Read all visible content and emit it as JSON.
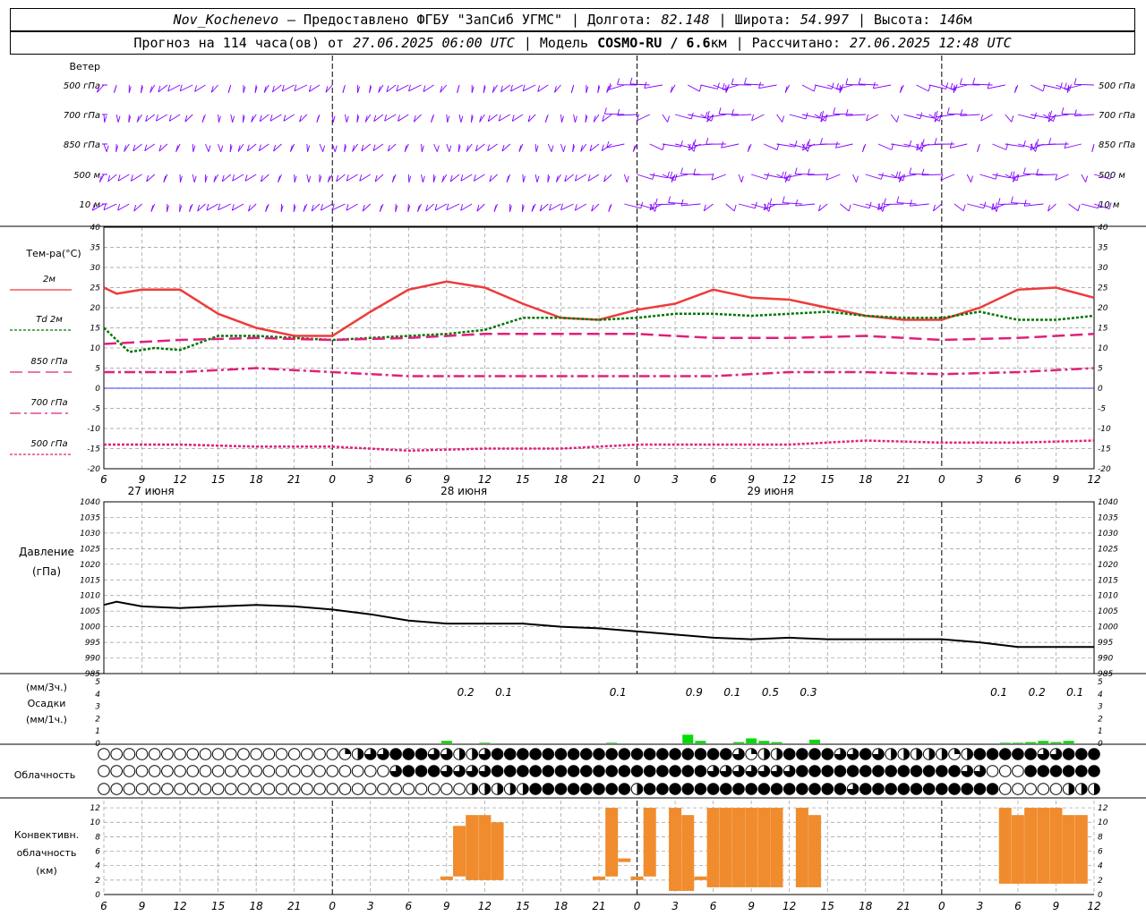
{
  "header": {
    "station": "Nov_Kochenevo",
    "provider": "– Предоставлено ФГБУ \"ЗапСиб УГМС\"",
    "lon_label": "| Долгота:",
    "lon": "82.148",
    "lat_label": "| Широта:",
    "lat": "54.997",
    "alt_label": "| Высота:",
    "alt": "146",
    "alt_unit": "м",
    "forecast_label": "Прогноз на 114 часа(ов) от",
    "forecast_start": "27.06.2025 06:00 UTC",
    "model_label": "| Модель",
    "model": "COSMO-RU / 6.6",
    "model_unit": "км",
    "calc_label": "| Рассчитано:",
    "calc_time": "27.06.2025 12:48 UTC"
  },
  "labels": {
    "wind_title": "Ветер",
    "wind_levels": [
      "500 гПа",
      "700 гПа",
      "850 гПа",
      "500 м",
      "10 м"
    ],
    "temp_title": "Тем-ра(°С)",
    "temp_legend": [
      "2м",
      "Td 2м",
      "850 гПа",
      "700 гПа",
      "500 гПа"
    ],
    "pressure_title": "Давление",
    "pressure_unit": "(гПа)",
    "precip_lines": [
      "(мм/3ч.)",
      "Осадки",
      "(мм/1ч.)"
    ],
    "cloud_title": "Облачность",
    "conv_lines": [
      "Конвективн.",
      "облачность",
      "(км)"
    ]
  },
  "colors": {
    "t2m": "#ee3b3b",
    "td2m": "#007700",
    "t850": "#e0207a",
    "t700": "#e0207a",
    "t500": "#e0207a",
    "wind": "#8000ff",
    "pressure": "#000000",
    "precip": "#00dd00",
    "conv": "#f08c2e",
    "zero_line": "#0000ff"
  },
  "chart_data": {
    "type": "line",
    "x_hours_utc": [
      6,
      9,
      12,
      15,
      18,
      21,
      0,
      3,
      6,
      9,
      12,
      15,
      18,
      21,
      0,
      3,
      6,
      9,
      12,
      15,
      18,
      21,
      0,
      3,
      6,
      9,
      12
    ],
    "x_days": [
      "27 июня",
      "28 июня",
      "29 июня"
    ],
    "x_max_hours": 78,
    "temperature": {
      "ylim": [
        -20,
        40
      ],
      "yticks": [
        -20,
        -15,
        -10,
        -5,
        0,
        5,
        10,
        15,
        20,
        25,
        30,
        35,
        40
      ],
      "series": [
        {
          "name": "2м",
          "x": [
            0,
            1,
            3,
            6,
            9,
            12,
            15,
            18,
            21,
            24,
            27,
            30,
            33,
            36,
            39,
            42,
            45,
            48,
            51,
            54,
            57,
            60,
            63,
            66,
            69,
            72,
            75,
            78
          ],
          "values": [
            25,
            23.5,
            24.5,
            24.5,
            18.5,
            15,
            13,
            13,
            19,
            24.5,
            26.5,
            25,
            21,
            17.5,
            17,
            19.5,
            21,
            24.5,
            22.5,
            22,
            20,
            18,
            17,
            17,
            20,
            24.5,
            25,
            22.5
          ]
        },
        {
          "name": "Td 2м",
          "x": [
            0,
            2,
            4,
            6,
            9,
            12,
            15,
            18,
            21,
            24,
            27,
            30,
            33,
            36,
            39,
            42,
            45,
            48,
            51,
            54,
            57,
            60,
            63,
            66,
            69,
            72,
            75,
            78
          ],
          "values": [
            15,
            9,
            10,
            9.5,
            13,
            13,
            12.5,
            12,
            12.5,
            13,
            13.5,
            14.5,
            17.5,
            17.5,
            17,
            17.5,
            18.5,
            18.5,
            18,
            18.5,
            19,
            18,
            17.5,
            17.5,
            19,
            17,
            17,
            18
          ]
        },
        {
          "name": "850 гПа",
          "x": [
            0,
            6,
            12,
            18,
            24,
            30,
            36,
            42,
            48,
            54,
            60,
            66,
            72,
            78
          ],
          "values": [
            11,
            12,
            12.5,
            12,
            12.5,
            13.5,
            13.5,
            13.5,
            12.5,
            12.5,
            13,
            12,
            12.5,
            13.5
          ]
        },
        {
          "name": "700 гПа",
          "x": [
            0,
            6,
            12,
            18,
            24,
            30,
            36,
            42,
            48,
            54,
            60,
            66,
            72,
            78
          ],
          "values": [
            4,
            4,
            5,
            4,
            3,
            3,
            3,
            3,
            3,
            4,
            4,
            3.5,
            4,
            5
          ]
        },
        {
          "name": "500 гПа",
          "x": [
            0,
            6,
            12,
            18,
            24,
            30,
            36,
            42,
            48,
            54,
            60,
            66,
            72,
            78
          ],
          "values": [
            -14,
            -14,
            -14.5,
            -14.5,
            -15.5,
            -15,
            -15,
            -14,
            -14,
            -14,
            -13,
            -13.5,
            -13.5,
            -13
          ]
        }
      ]
    },
    "pressure": {
      "ylim": [
        985,
        1040
      ],
      "yticks": [
        985,
        990,
        995,
        1000,
        1005,
        1010,
        1015,
        1020,
        1025,
        1030,
        1035,
        1040
      ],
      "x": [
        0,
        1,
        3,
        6,
        9,
        12,
        15,
        18,
        21,
        24,
        27,
        30,
        33,
        36,
        39,
        42,
        45,
        48,
        51,
        54,
        57,
        60,
        63,
        66,
        69,
        72,
        75,
        78
      ],
      "values": [
        1007,
        1008,
        1006.5,
        1006,
        1006.5,
        1007,
        1006.5,
        1005.5,
        1004,
        1002,
        1001,
        1001,
        1001,
        1000,
        999.5,
        998.5,
        997.5,
        996.5,
        996,
        996.5,
        996,
        996,
        996,
        996,
        995,
        993.5,
        993.5,
        993.5
      ]
    },
    "precipitation": {
      "ylim": [
        0,
        5
      ],
      "yticks": [
        0,
        1,
        2,
        3,
        4,
        5
      ],
      "labels": [
        {
          "x": 28.5,
          "text": "0.2"
        },
        {
          "x": 31.5,
          "text": "0.1"
        },
        {
          "x": 40.5,
          "text": "0.1"
        },
        {
          "x": 46.5,
          "text": "0.9"
        },
        {
          "x": 49.5,
          "text": "0.1"
        },
        {
          "x": 52.5,
          "text": "0.5"
        },
        {
          "x": 55.5,
          "text": "0.3"
        },
        {
          "x": 70.5,
          "text": "0.1"
        },
        {
          "x": 73.5,
          "text": "0.2"
        },
        {
          "x": 76.5,
          "text": "0.1"
        }
      ],
      "bars": [
        {
          "x": 27,
          "v": 0.2
        },
        {
          "x": 30,
          "v": 0.05
        },
        {
          "x": 40,
          "v": 0.05
        },
        {
          "x": 46,
          "v": 0.7
        },
        {
          "x": 47,
          "v": 0.2
        },
        {
          "x": 50,
          "v": 0.1
        },
        {
          "x": 51,
          "v": 0.4
        },
        {
          "x": 52,
          "v": 0.2
        },
        {
          "x": 53,
          "v": 0.1
        },
        {
          "x": 56,
          "v": 0.3
        },
        {
          "x": 71,
          "v": 0.05
        },
        {
          "x": 72,
          "v": 0.05
        },
        {
          "x": 73,
          "v": 0.1
        },
        {
          "x": 74,
          "v": 0.2
        },
        {
          "x": 75,
          "v": 0.1
        },
        {
          "x": 76,
          "v": 0.2
        }
      ]
    },
    "cloud_rows": {
      "note": "fraction of circle filled, one per hour 0..78",
      "high": "0000000000000000000123344433223444444444444444444431224444334322222124444433444433",
      "mid": "0000000000000000000000034443333444444444444444443333333444444444444433000444444444",
      "low": "0000000000000000000000000000022222444444442444444444444444434444444444400000222444444444"
    },
    "convective_cloud": {
      "ylim": [
        0,
        13
      ],
      "yticks": [
        0,
        2,
        4,
        6,
        8,
        10,
        12
      ],
      "bars": [
        {
          "x": 27,
          "base": 2.5,
          "top": 2.5
        },
        {
          "x": 28,
          "base": 2.5,
          "top": 9.5
        },
        {
          "x": 29,
          "base": 2,
          "top": 11
        },
        {
          "x": 30,
          "base": 2,
          "top": 11
        },
        {
          "x": 31,
          "base": 2,
          "top": 10
        },
        {
          "x": 39,
          "base": 2.5,
          "top": 2.5
        },
        {
          "x": 40,
          "base": 2.5,
          "top": 12
        },
        {
          "x": 41,
          "base": 4.5,
          "top": 5
        },
        {
          "x": 42,
          "base": 2.5,
          "top": 2.5
        },
        {
          "x": 43,
          "base": 2.5,
          "top": 12
        },
        {
          "x": 45,
          "base": 0.5,
          "top": 12
        },
        {
          "x": 46,
          "base": 0.5,
          "top": 11
        },
        {
          "x": 47,
          "base": 2.5,
          "top": 2.5
        },
        {
          "x": 48,
          "base": 1,
          "top": 12
        },
        {
          "x": 49,
          "base": 1,
          "top": 12
        },
        {
          "x": 50,
          "base": 1,
          "top": 12
        },
        {
          "x": 51,
          "base": 1,
          "top": 12
        },
        {
          "x": 52,
          "base": 1,
          "top": 12
        },
        {
          "x": 53,
          "base": 1,
          "top": 12
        },
        {
          "x": 55,
          "base": 1,
          "top": 12
        },
        {
          "x": 56,
          "base": 1,
          "top": 11
        },
        {
          "x": 71,
          "base": 1.5,
          "top": 12
        },
        {
          "x": 72,
          "base": 1.5,
          "top": 11
        },
        {
          "x": 73,
          "base": 1.5,
          "top": 12
        },
        {
          "x": 74,
          "base": 1.5,
          "top": 12
        },
        {
          "x": 75,
          "base": 1.5,
          "top": 12
        },
        {
          "x": 76,
          "base": 1.5,
          "top": 11
        },
        {
          "x": 77,
          "base": 1.5,
          "top": 11
        }
      ]
    }
  }
}
